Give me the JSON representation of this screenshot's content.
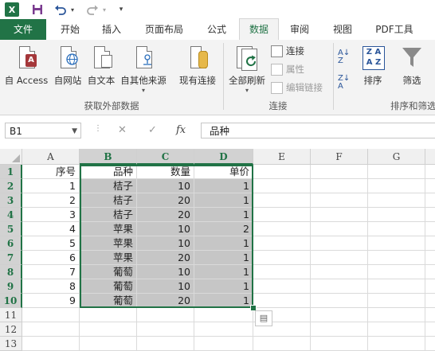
{
  "qat": {
    "app_icon": "X",
    "save_icon": "save-icon",
    "undo_icon": "undo-icon",
    "redo_icon": "redo-icon",
    "customize_icon": "customize-qat-icon"
  },
  "tabs": [
    "文件",
    "开始",
    "插入",
    "页面布局",
    "公式",
    "数据",
    "审阅",
    "视图",
    "PDF工具"
  ],
  "ribbon": {
    "groups": {
      "external": {
        "label": "获取外部数据",
        "buttons": [
          "自 Access",
          "自网站",
          "自文本",
          "自其他来源",
          "现有连接"
        ]
      },
      "connections": {
        "label": "连接",
        "refresh_label": "全部刷新",
        "small": [
          "连接",
          "属性",
          "编辑链接"
        ]
      },
      "sort": {
        "label": "排序和筛选",
        "sort_label": "排序",
        "filter_label": "筛选"
      }
    }
  },
  "formula_bar": {
    "name_box": "B1",
    "fx_label": "fx",
    "cancel": "✕",
    "confirm": "✓",
    "formula": "品种"
  },
  "grid": {
    "columns": [
      "A",
      "B",
      "C",
      "D",
      "E",
      "F",
      "G"
    ],
    "rows": [
      "1",
      "2",
      "3",
      "4",
      "5",
      "6",
      "7",
      "8",
      "9",
      "10",
      "11",
      "12",
      "13"
    ],
    "data": [
      [
        "序号",
        "品种",
        "数量",
        "单价"
      ],
      [
        "1",
        "桔子",
        "10",
        "1"
      ],
      [
        "2",
        "桔子",
        "20",
        "1"
      ],
      [
        "3",
        "桔子",
        "20",
        "1"
      ],
      [
        "4",
        "苹果",
        "10",
        "2"
      ],
      [
        "5",
        "苹果",
        "10",
        "1"
      ],
      [
        "6",
        "苹果",
        "20",
        "1"
      ],
      [
        "7",
        "葡萄",
        "10",
        "1"
      ],
      [
        "8",
        "葡萄",
        "10",
        "1"
      ],
      [
        "9",
        "葡萄",
        "20",
        "1"
      ]
    ]
  },
  "colors": {
    "accent": "#217346",
    "selection_fill": "#c6c6c6"
  }
}
